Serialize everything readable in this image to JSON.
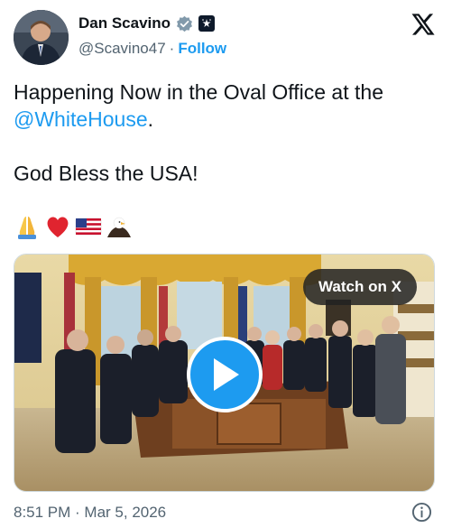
{
  "author": {
    "display_name": "Dan Scavino",
    "handle": "@Scavino47",
    "separator": "·",
    "follow_label": "Follow"
  },
  "tweet": {
    "line1_prefix": "Happening Now in the Oval Office at the ",
    "mention": "@WhiteHouse",
    "line1_suffix": ".",
    "line2": "God Bless the USA!",
    "emojis": [
      "folded-hands",
      "red-heart",
      "us-flag",
      "eagle"
    ]
  },
  "media": {
    "watch_label": "Watch on X"
  },
  "footer": {
    "timestamp": "8:51 PM · Mar 5, 2026"
  },
  "colors": {
    "accent": "#1d9bf0",
    "text": "#0f1419",
    "muted": "#536471"
  }
}
